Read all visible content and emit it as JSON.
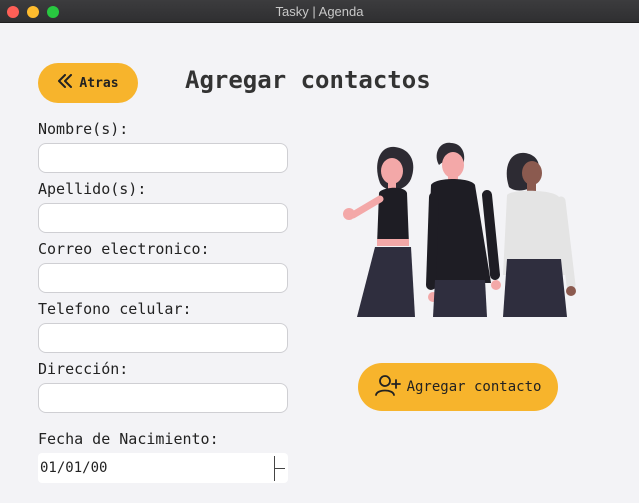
{
  "window": {
    "title": "Tasky | Agenda"
  },
  "header": {
    "back_label": "Atras",
    "title": "Agregar contactos"
  },
  "form": {
    "fields": [
      {
        "label": "Nombre(s):",
        "value": ""
      },
      {
        "label": "Apellido(s):",
        "value": ""
      },
      {
        "label": "Correo electronico:",
        "value": ""
      },
      {
        "label": "Telefono celular:",
        "value": ""
      },
      {
        "label": "Dirección:",
        "value": ""
      }
    ],
    "birthdate": {
      "label": "Fecha de Nacimiento:",
      "value": "01/01/00"
    }
  },
  "actions": {
    "add_contact_label": "Agregar contacto"
  },
  "icons": {
    "back": "double-chevron-left-icon",
    "add_contact": "user-plus-icon"
  },
  "colors": {
    "accent": "#f7b42c",
    "background": "#f3f3f6"
  }
}
